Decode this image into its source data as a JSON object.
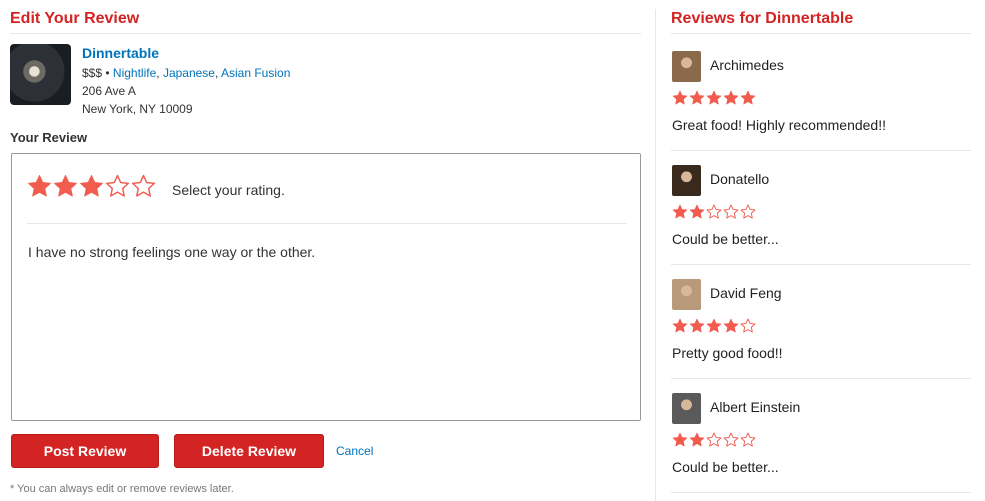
{
  "colors": {
    "accent": "#d32323",
    "link": "#0073bb",
    "star": "#f15c4f"
  },
  "edit": {
    "title": "Edit Your Review",
    "business": {
      "photo_icon": "food-photo",
      "name": "Dinnertable",
      "price": "$$$",
      "separator": " • ",
      "categories": [
        "Nightlife",
        "Japanese",
        "Asian Fusion"
      ],
      "category_separator": ", ",
      "address_line1": "206 Ave A",
      "address_line2": "New York, NY 10009"
    },
    "your_review_label": "Your Review",
    "rating": 3,
    "rating_max": 5,
    "rating_prompt": "Select your rating.",
    "review_text": "I have no strong feelings one way or the other.",
    "post_button": "Post Review",
    "delete_button": "Delete Review",
    "cancel_link": "Cancel",
    "note": "* You can always edit or remove reviews later."
  },
  "sidebar": {
    "title": "Reviews for Dinnertable",
    "reviews": [
      {
        "name": "Archimedes",
        "rating": 5,
        "text": "Great food! Highly recommended!!",
        "avatar_color": "#8a6a4a"
      },
      {
        "name": "Donatello",
        "rating": 2,
        "text": "Could be better...",
        "avatar_color": "#3a2a1e"
      },
      {
        "name": "David Feng",
        "rating": 4,
        "text": "Pretty good food!!",
        "avatar_color": "#b89a7a"
      },
      {
        "name": "Albert Einstein",
        "rating": 2,
        "text": "Could be better...",
        "avatar_color": "#5a5a5a"
      }
    ]
  }
}
